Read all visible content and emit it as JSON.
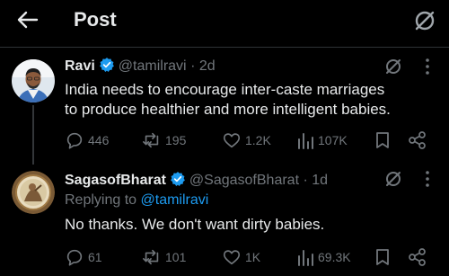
{
  "header": {
    "title": "Post"
  },
  "tweets": [
    {
      "name": "Ravi",
      "handle": "@tamilravi",
      "time": "· 2d",
      "text_line1": "India needs to encourage inter-caste marriages",
      "text_line2": "to produce healthier and more intelligent babies.",
      "replies": "446",
      "reposts": "195",
      "likes": "1.2K",
      "views": "107K"
    },
    {
      "name": "SagasofBharat",
      "handle": "@SagasofBharat",
      "time": "· 1d",
      "replying_label": "Replying to",
      "replying_handle": "@tamilravi",
      "text": "No thanks. We don't want dirty babies.",
      "replies": "61",
      "reposts": "101",
      "likes": "1K",
      "views": "69.3K"
    }
  ],
  "colors": {
    "background": "#000000",
    "text": "#e7e9ea",
    "muted": "#71767b",
    "link": "#1d9bf0",
    "verified": "#1d9bf0"
  }
}
